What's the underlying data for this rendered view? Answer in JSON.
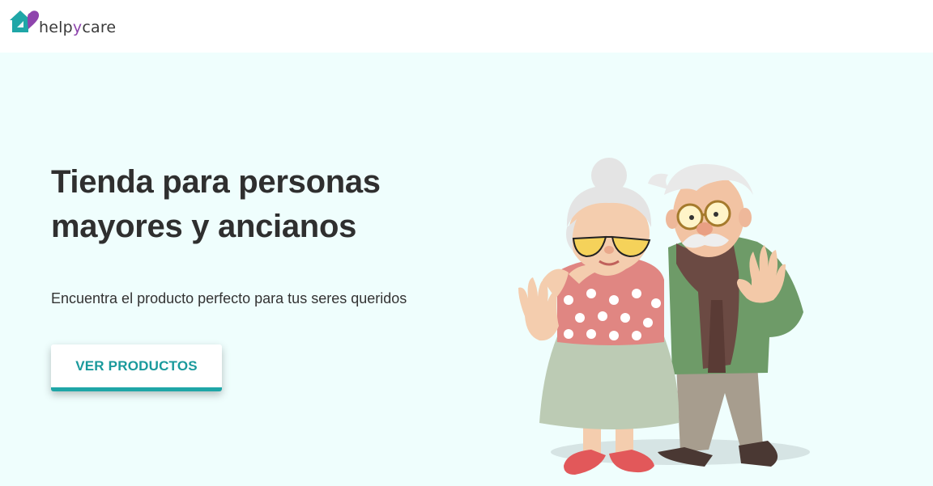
{
  "header": {
    "logo": {
      "text_prefix": "help",
      "text_accent": "y",
      "text_suffix": "care",
      "icon": "heart-house-icon",
      "colors": {
        "teal": "#1fa6a7",
        "purple": "#8e44ad"
      }
    }
  },
  "hero": {
    "title_line1": "Tienda para personas",
    "title_line2": "mayores y ancianos",
    "subtitle": "Encuentra el producto perfecto para tus seres queridos",
    "cta_label": "VER PRODUCTOS",
    "illustration": "elderly-couple-waving-illustration",
    "background_color": "#effefd",
    "accent_color": "#1fa6a7"
  }
}
